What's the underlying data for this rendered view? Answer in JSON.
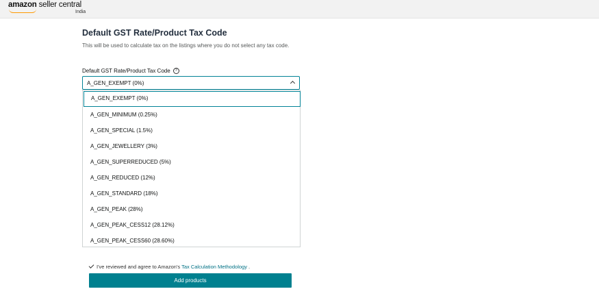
{
  "header": {
    "logo_brand": "amazon",
    "logo_product": "seller central",
    "logo_region": "India"
  },
  "section": {
    "title": "Default GST Rate/Product Tax Code",
    "description": "This will be used to calculate tax on the listings where you do not select any tax code."
  },
  "field": {
    "label": "Default GST Rate/Product Tax Code",
    "selected_value": "A_GEN_EXEMPT (0%)"
  },
  "options": [
    "A_GEN_EXEMPT (0%)",
    "A_GEN_MINIMUM (0.25%)",
    "A_GEN_SPECIAL (1.5%)",
    "A_GEN_JEWELLERY (3%)",
    "A_GEN_SUPERREDUCED (5%)",
    "A_GEN_REDUCED (12%)",
    "A_GEN_STANDARD (18%)",
    "A_GEN_PEAK (28%)",
    "A_GEN_PEAK_CESS12 (28.12%)",
    "A_GEN_PEAK_CESS60 (28.60%)"
  ],
  "agreement": {
    "text": "I've reviewed and agree to Amazon's",
    "link": "Tax Calculation Methodology",
    "suffix": "."
  },
  "buttons": {
    "add_products": "Add products"
  },
  "colors": {
    "accent": "#008296",
    "button": "#00808f",
    "link": "#007185"
  }
}
